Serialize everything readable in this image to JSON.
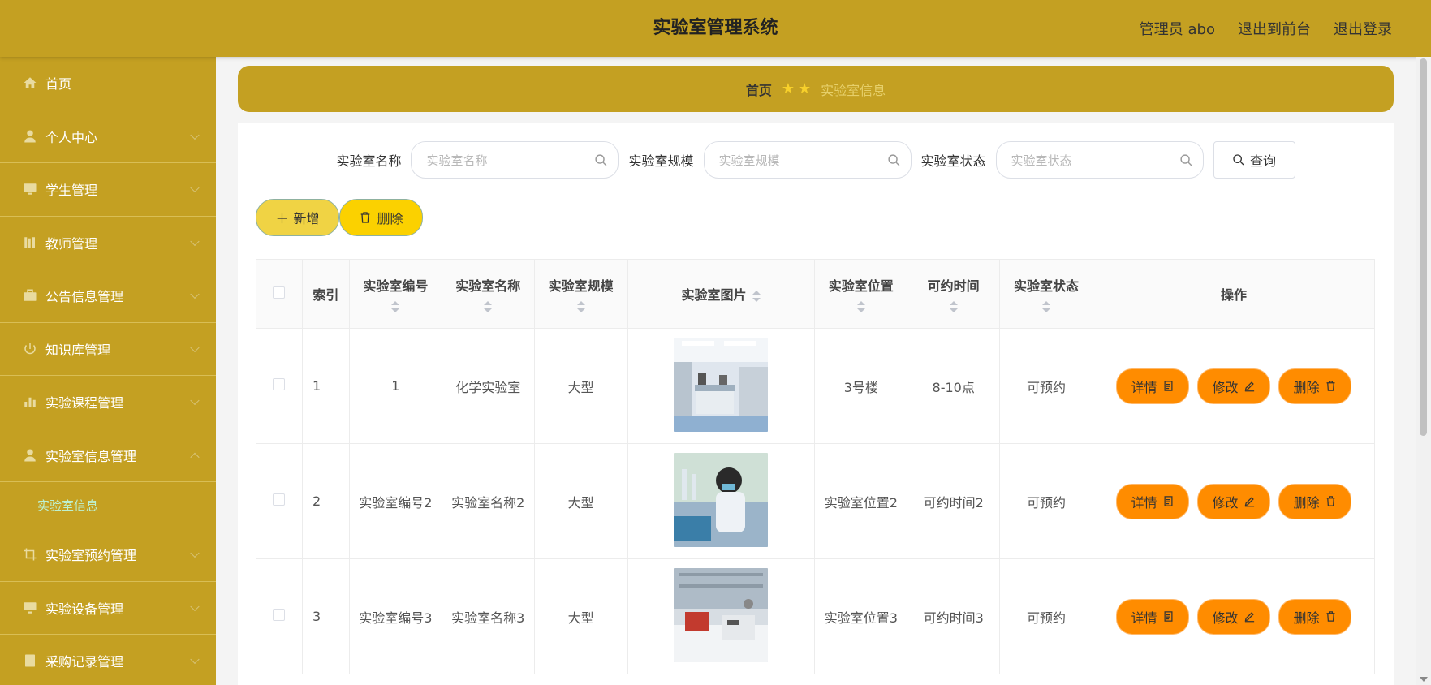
{
  "header": {
    "title": "实验室管理系统",
    "admin": "管理员 abo",
    "to_front": "退出到前台",
    "logout": "退出登录"
  },
  "sidebar": {
    "items": [
      {
        "label": "首页",
        "icon": "home-icon"
      },
      {
        "label": "个人中心",
        "icon": "user-icon"
      },
      {
        "label": "学生管理",
        "icon": "monitor-icon"
      },
      {
        "label": "教师管理",
        "icon": "books-icon"
      },
      {
        "label": "公告信息管理",
        "icon": "briefcase-icon"
      },
      {
        "label": "知识库管理",
        "icon": "power-icon"
      },
      {
        "label": "实验课程管理",
        "icon": "bar-chart-icon"
      },
      {
        "label": "实验室信息管理",
        "icon": "user-icon"
      },
      {
        "label": "实验室预约管理",
        "icon": "crop-icon"
      },
      {
        "label": "实验设备管理",
        "icon": "monitor-icon"
      },
      {
        "label": "采购记录管理",
        "icon": "document-icon"
      }
    ],
    "submenu_label": "实验室信息"
  },
  "breadcrumb": {
    "home": "首页",
    "current": "实验室信息"
  },
  "search": {
    "name_label": "实验室名称",
    "name_placeholder": "实验室名称",
    "scale_label": "实验室规模",
    "scale_placeholder": "实验室规模",
    "status_label": "实验室状态",
    "status_placeholder": "实验室状态",
    "query_label": "查询"
  },
  "actions": {
    "add_label": "新增",
    "delete_label": "删除"
  },
  "table": {
    "headers": {
      "index": "索引",
      "code": "实验室编号",
      "name": "实验室名称",
      "scale": "实验室规模",
      "image": "实验室图片",
      "location": "实验室位置",
      "time": "可约时间",
      "status": "实验室状态",
      "ops": "操作"
    },
    "rows": [
      {
        "index": "1",
        "code": "1",
        "name": "化学实验室",
        "scale": "大型",
        "location": "3号楼",
        "time": "8-10点",
        "status": "可预约"
      },
      {
        "index": "2",
        "code": "实验室编号2",
        "name": "实验室名称2",
        "scale": "大型",
        "location": "实验室位置2",
        "time": "可约时间2",
        "status": "可预约"
      },
      {
        "index": "3",
        "code": "实验室编号3",
        "name": "实验室名称3",
        "scale": "大型",
        "location": "实验室位置3",
        "time": "可约时间3",
        "status": "可预约"
      }
    ],
    "op_labels": {
      "detail": "详情",
      "edit": "修改",
      "delete": "删除"
    }
  },
  "colors": {
    "brand": "#c4a022",
    "orange": "#ff8c00",
    "submenu_active": "#bdf1d0"
  }
}
